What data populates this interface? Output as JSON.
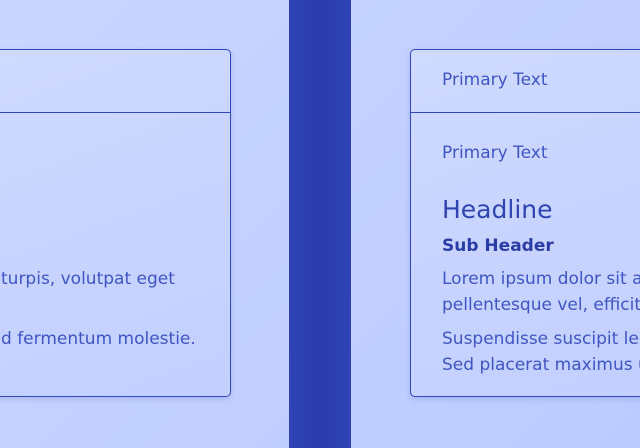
{
  "left_card": {
    "body_line_1": "turpis, volutpat eget",
    "body_line_2": "d fermentum molestie."
  },
  "right_card": {
    "header_text": "Primary Text",
    "primary_text": "Primary Text",
    "headline": "Headline",
    "sub_header": "Sub Header",
    "paragraph_1_line_1": "Lorem ipsum dolor sit a",
    "paragraph_1_line_2": "pellentesque vel, efficitu",
    "paragraph_2_line_1": "Suspendisse suscipit lec",
    "paragraph_2_line_2": "Sed placerat maximus u"
  },
  "colors": {
    "background": "#c4d2ff",
    "divider": "#2d40b2",
    "card_border": "#3348b8",
    "text": "#3f55c2"
  }
}
